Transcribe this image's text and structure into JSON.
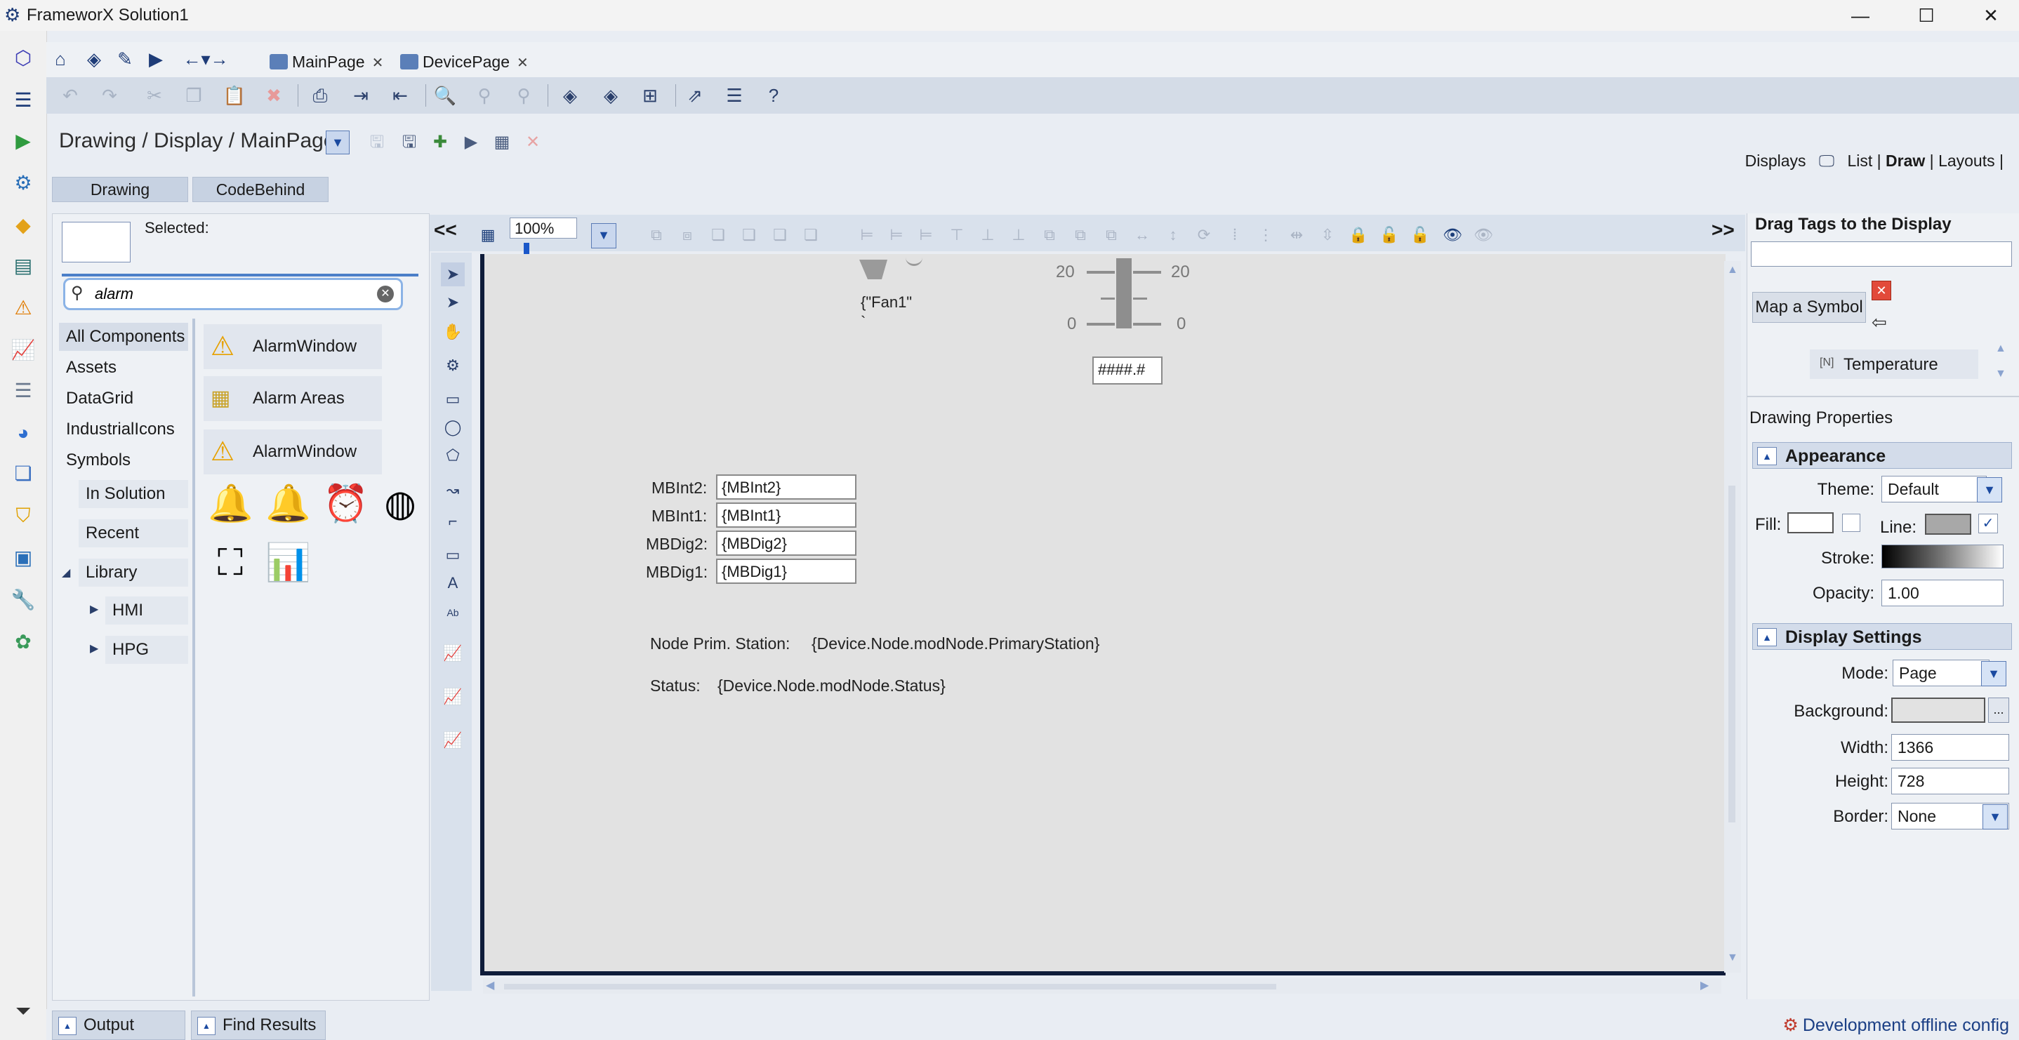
{
  "window": {
    "title": "FrameworX Solution1",
    "minimize": "—",
    "maximize": "☐",
    "close": "✕"
  },
  "nav": {
    "tabs": [
      {
        "label": "MainPage",
        "close": "✕"
      },
      {
        "label": "DevicePage",
        "close": "✕"
      }
    ]
  },
  "breadcrumb": {
    "path": "Drawing / Display / MainPage",
    "dropdown": "▼"
  },
  "displays_nav": {
    "label": "Displays",
    "list": "List",
    "draw": "Draw",
    "layouts": "Layouts"
  },
  "subtabs": {
    "drawing": "Drawing",
    "codebehind": "CodeBehind"
  },
  "left_panel": {
    "selected_label": "Selected:",
    "search_value": "alarm",
    "categories": [
      "All Components",
      "Assets",
      "DataGrid",
      "IndustrialIcons",
      "Symbols"
    ],
    "subcategories": [
      "In Solution",
      "Recent",
      "Library"
    ],
    "library_children": [
      "HMI",
      "HPG"
    ],
    "components": [
      "AlarmWindow",
      "Alarm Areas",
      "AlarmWindow"
    ]
  },
  "canvas": {
    "collapse_left": "<<",
    "expand_right": ">>",
    "zoom": "100%",
    "fan_label": "{\"Fan1\"",
    "fan_sub": "`",
    "scale_top_left": "20",
    "scale_top_right": "20",
    "scale_bottom_left": "0",
    "scale_bottom_right": "0",
    "value_box": "####.#",
    "fields": [
      {
        "label": "MBInt2:",
        "value": "{MBInt2}"
      },
      {
        "label": "MBInt1:",
        "value": "{MBInt1}"
      },
      {
        "label": "MBDig2:",
        "value": "{MBDig2}"
      },
      {
        "label": "MBDig1:",
        "value": "{MBDig1}"
      }
    ],
    "node_label": "Node Prim. Station:",
    "node_value": "{Device.Node.modNode.PrimaryStation}",
    "status_label": "Status:",
    "status_value": "{Device.Node.modNode.Status}"
  },
  "right_panel": {
    "drag_tags_title": "Drag Tags to the Display",
    "map_symbol": "Map a Symbol",
    "temperature_prefix": "[N]",
    "temperature": "Temperature",
    "drawing_properties": "Drawing Properties",
    "appearance": {
      "title": "Appearance",
      "theme_label": "Theme:",
      "theme_value": "Default",
      "fill_label": "Fill:",
      "line_label": "Line:",
      "line_checked": "✓",
      "stroke_label": "Stroke:",
      "opacity_label": "Opacity:",
      "opacity_value": "1.00"
    },
    "display_settings": {
      "title": "Display Settings",
      "mode_label": "Mode:",
      "mode_value": "Page",
      "background_label": "Background:",
      "background_more": "...",
      "width_label": "Width:",
      "width_value": "1366",
      "height_label": "Height:",
      "height_value": "728",
      "border_label": "Border:",
      "border_value": "None"
    }
  },
  "bottom": {
    "output": "Output",
    "find_results": "Find Results",
    "status": "Development offline config"
  },
  "colors": {
    "accent": "#1e3c78",
    "canvas_bg": "#e2e2e2",
    "page_border": "#0f1c3a",
    "toolbar": "#d4dce7"
  }
}
